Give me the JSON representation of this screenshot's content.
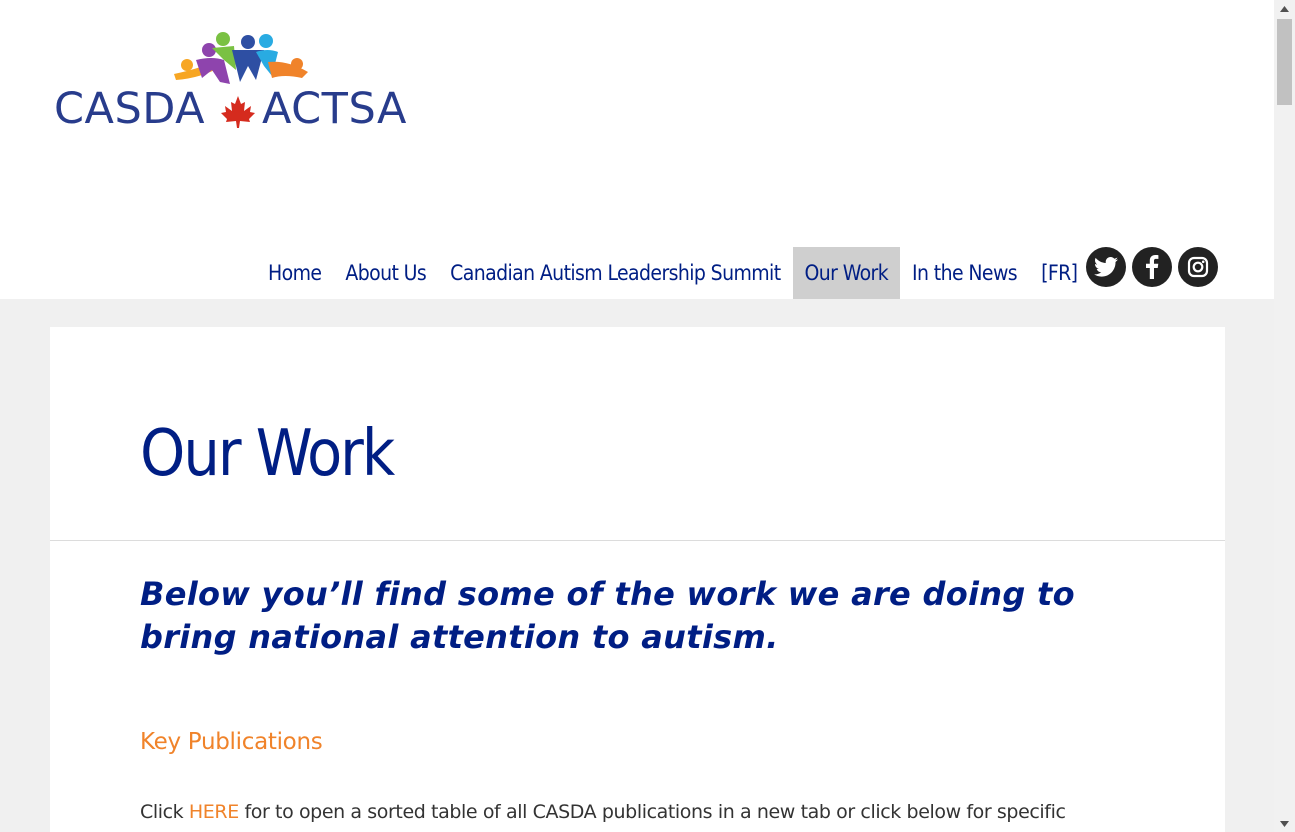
{
  "logo": {
    "left_text": "CASDA",
    "right_text": "ACTSA",
    "icon": "maple-leaf-icon",
    "colors": {
      "text": "#283c8c",
      "leaf": "#d52b1e",
      "figures": [
        "#f7a623",
        "#8e44ad",
        "#7ac143",
        "#2e4fa3",
        "#29abe2",
        "#f0832a"
      ]
    }
  },
  "nav": {
    "items": [
      {
        "label": "Home"
      },
      {
        "label": "About Us"
      },
      {
        "label": "Canadian Autism Leadership Summit"
      },
      {
        "label": "Our Work",
        "active": true
      },
      {
        "label": "In the News"
      },
      {
        "label": "[FR]"
      }
    ]
  },
  "social": [
    "twitter-icon",
    "facebook-icon",
    "instagram-icon"
  ],
  "main": {
    "title": "Our Work",
    "lead": "Below you’ll find some of the work we are doing to bring national attention to autism.",
    "section_heading": "Key Publications",
    "body_prefix": "Click ",
    "body_link": "HERE",
    "body_suffix": " for to open a sorted table of all CASDA publications in a new tab or click below for specific"
  },
  "colors": {
    "brand_blue": "#001e84",
    "accent_orange": "#f0832a",
    "active_nav_bg": "#cfcfcf",
    "page_bg": "#f0f0f0"
  }
}
